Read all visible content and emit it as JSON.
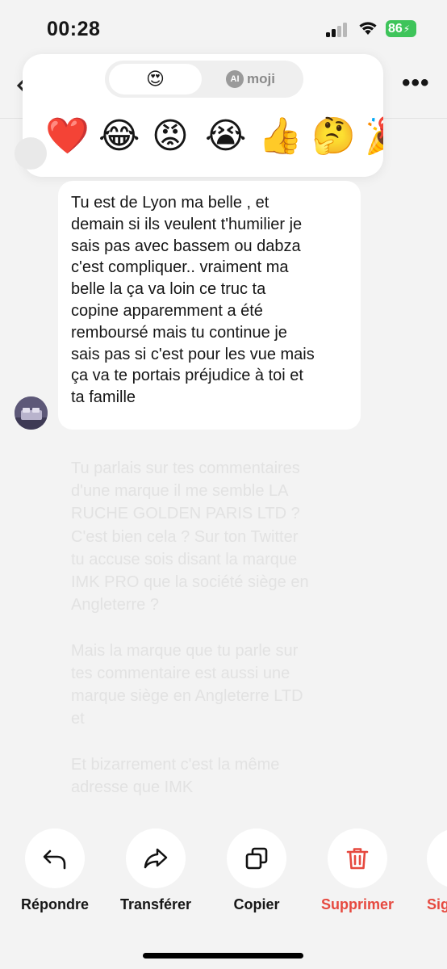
{
  "status_bar": {
    "time": "00:28",
    "battery": "86"
  },
  "reaction_panel": {
    "tabs": [
      {
        "label": "😍",
        "selected": true
      },
      {
        "label": "moji",
        "badge": "AI",
        "selected": false
      }
    ],
    "emojis": [
      "❤️",
      "😂",
      "😡",
      "😭",
      "👍",
      "🤔",
      "🎉"
    ]
  },
  "message": {
    "text": "Tu est de Lyon ma belle , et\ndemain si ils veulent t'humilier je\nsais pas avec bassem ou dabza\nc'est compliquer.. vraiment ma\nbelle la ça va loin ce truc ta\ncopine apparemment a été\nremboursé mais tu continue je\nsais pas si c'est pour les vue mais\nça va te portais préjudice à toi et\nta famille"
  },
  "faded_message": {
    "text": "Tu parlais sur tes commentaires\nd'une marque il me semble LA\nRUCHE GOLDEN PARIS LTD ?\nC'est bien cela ? Sur ton Twitter\ntu accuse sois disant la marque\nIMK PRO que la société siège en\nAngleterre ?\n\nMais la marque que tu parle sur\ntes commentaire est aussi une\nmarque siège en Angleterre LTD\net\n\nEt bizarrement c'est la même\nadresse que IMK"
  },
  "actions": [
    {
      "label": "Répondre",
      "icon": "reply-icon"
    },
    {
      "label": "Transférer",
      "icon": "forward-icon"
    },
    {
      "label": "Copier",
      "icon": "copy-icon"
    },
    {
      "label": "Supprimer",
      "icon": "trash-icon",
      "color": "#e6493f"
    },
    {
      "label": "Sig",
      "icon": "report-icon",
      "color": "#e6493f"
    }
  ],
  "colors": {
    "background": "#f3f3f3",
    "danger": "#e6493f",
    "battery": "#3ec45a"
  }
}
